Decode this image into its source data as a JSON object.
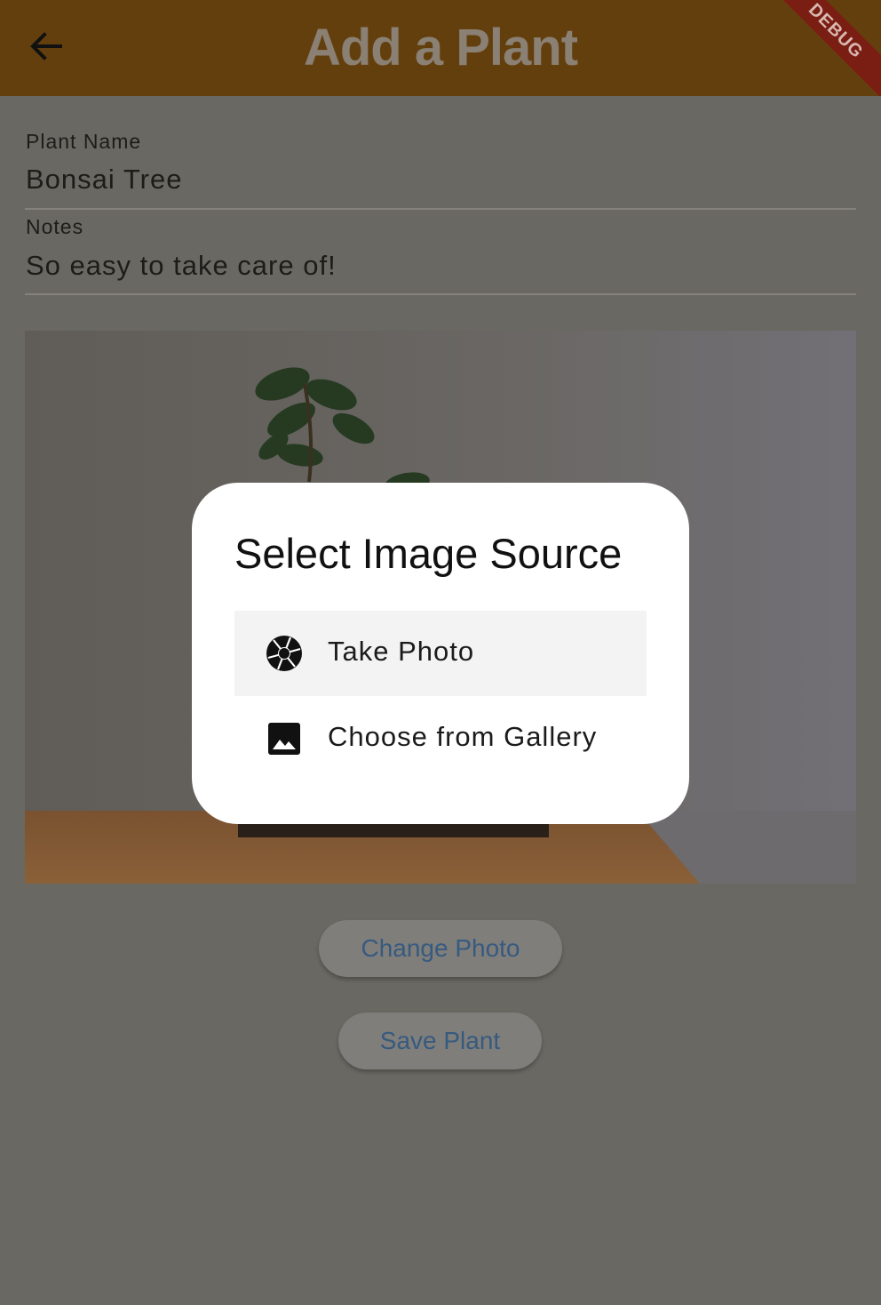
{
  "appbar": {
    "title": "Add a Plant",
    "back_icon": "arrow-back-icon",
    "debug_banner": "DEBUG"
  },
  "form": {
    "plant_name_label": "Plant Name",
    "plant_name_value": "Bonsai Tree",
    "notes_label": "Notes",
    "notes_value": "So easy to take care of!"
  },
  "buttons": {
    "change_photo": "Change Photo",
    "save_plant": "Save Plant"
  },
  "dialog": {
    "title": "Select Image Source",
    "options": [
      {
        "label": "Take Photo",
        "icon": "camera-shutter-icon"
      },
      {
        "label": "Choose from Gallery",
        "icon": "image-icon"
      }
    ]
  },
  "colors": {
    "appbar": "#643f0e",
    "scrim_background": "#6a6862",
    "button_text": "#365a80",
    "dialog": "#ffffff"
  }
}
